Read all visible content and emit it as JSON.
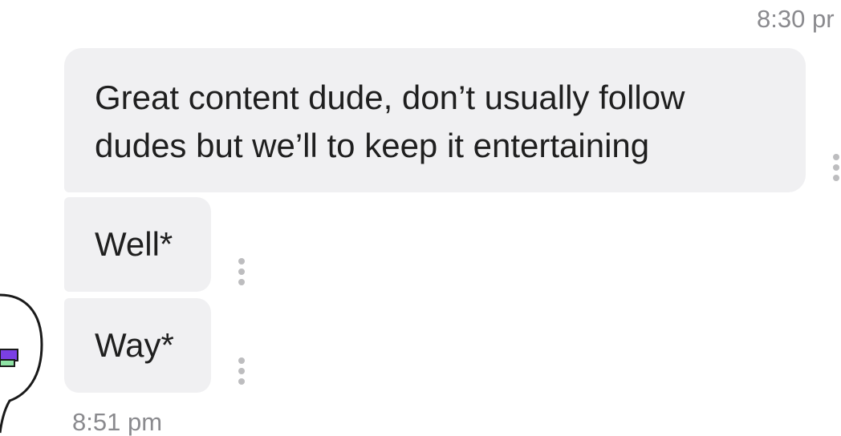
{
  "timestamps": {
    "top": "8:30 pr",
    "bottom": "8:51 pm"
  },
  "messages": [
    {
      "lines": [
        "Great content dude, don’t usually follow",
        "dudes but we’ll to keep it entertaining"
      ]
    },
    {
      "lines": [
        "Well*"
      ]
    },
    {
      "lines": [
        "Way*"
      ]
    }
  ],
  "icons": {
    "more_options": "vertical-ellipsis-icon",
    "avatar": "cartoon-avatar-icon"
  },
  "colors": {
    "bubble_bg": "#f0f0f2",
    "timestamp": "#8a8a8e",
    "avatar_purple": "#7b3fe4",
    "avatar_green": "#8fe3a5"
  }
}
